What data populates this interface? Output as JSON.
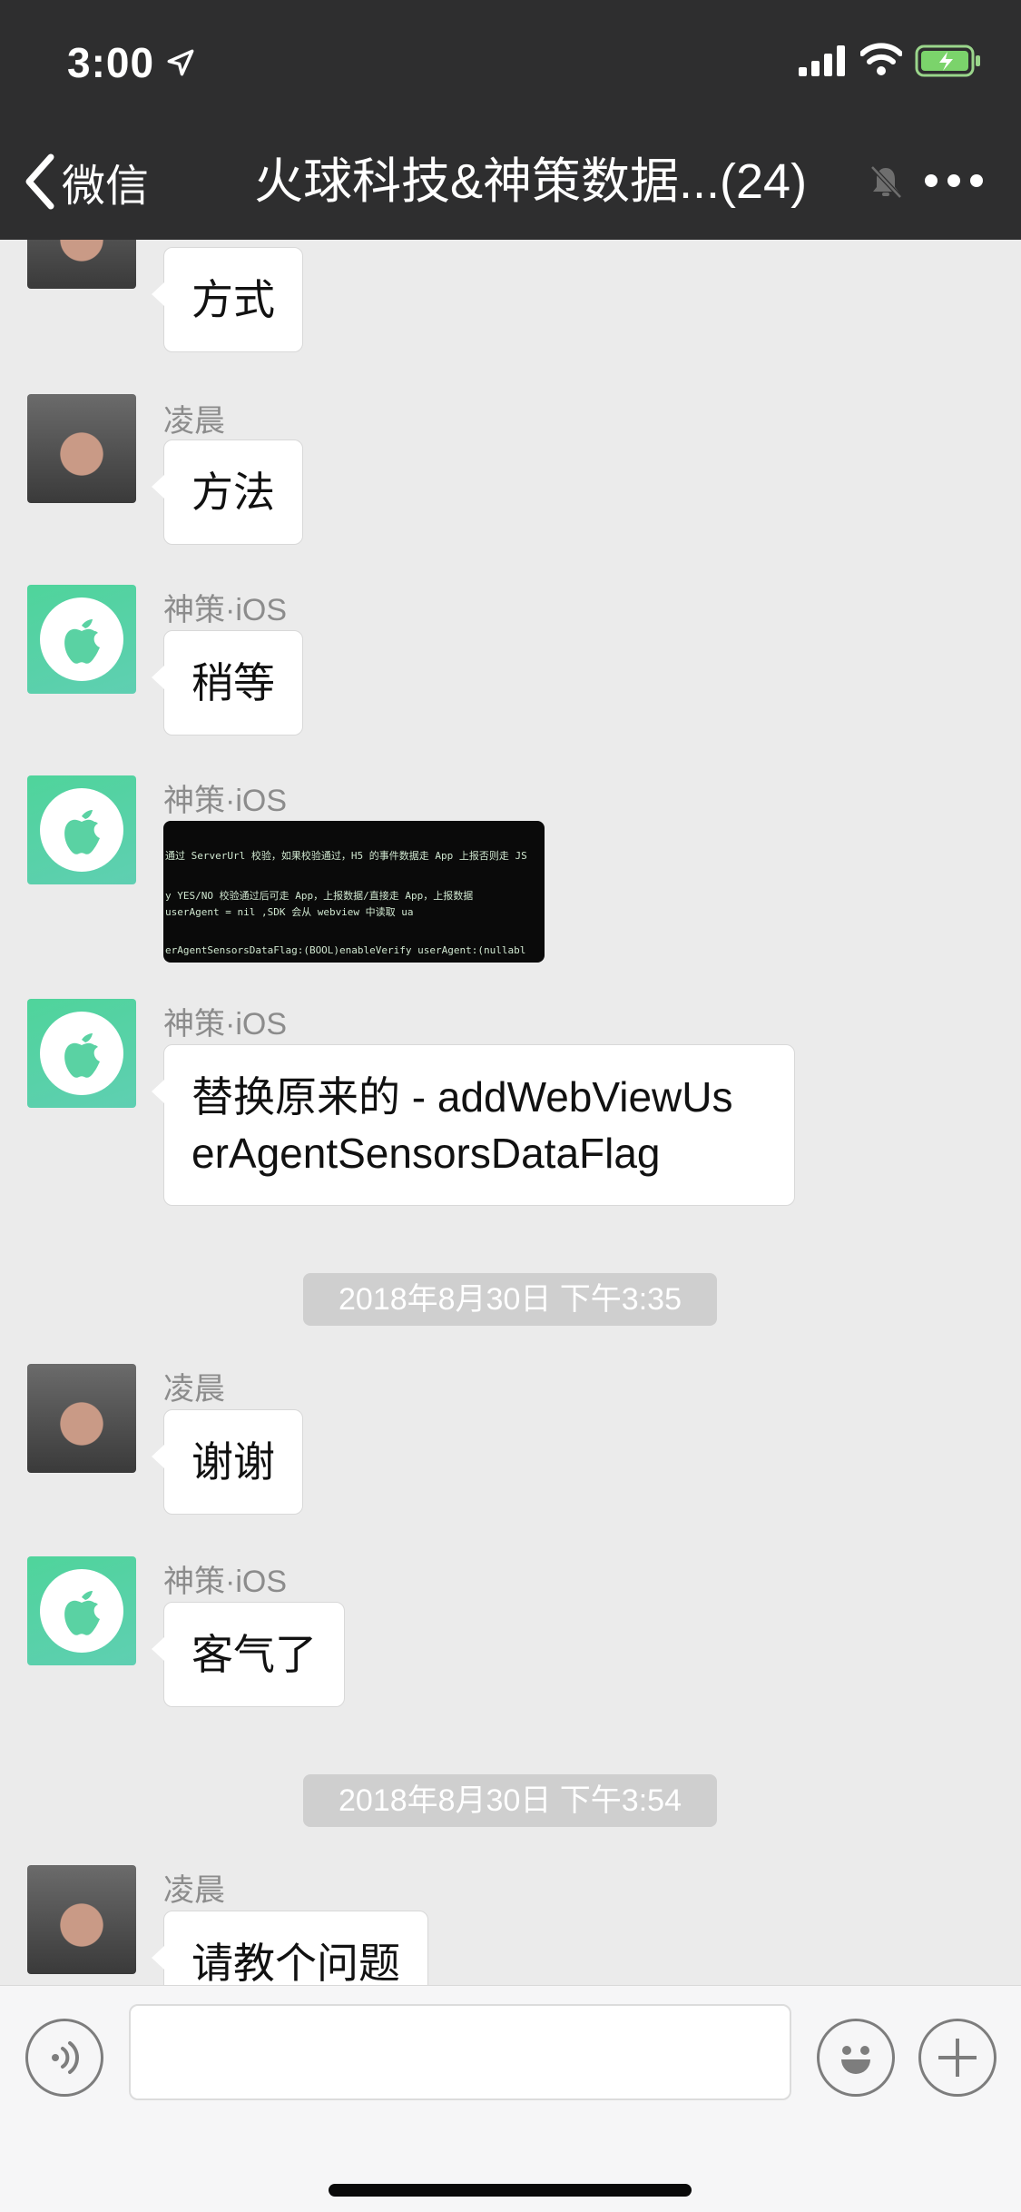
{
  "status": {
    "time": "3:00"
  },
  "header": {
    "back_label": "微信",
    "title": "火球科技&神策数据...(24)"
  },
  "messages": [
    {
      "sender": "",
      "text": "方式"
    },
    {
      "sender": "凌晨",
      "text": "方法"
    },
    {
      "sender": "神策·iOS",
      "text": "稍等"
    },
    {
      "sender": "神策·iOS",
      "image_lines": [
        "通过 ServerUrl 校验，如果校验通过，H5 的事件数据走 App 上报否则走 JS",
        "y YES/NO   校验通过后可走 App，上报数据/直接走 App，上报数据",
        "userAgent = nil ,SDK 会从 webview 中读取 ua",
        "erAgentSensorsDataFlag:(BOOL)enableVerify userAgent:(nullabl"
      ]
    },
    {
      "sender": "神策·iOS",
      "text_line1": "替换原来的 - addWebViewUs",
      "text_line2": "erAgentSensorsDataFlag"
    },
    {
      "timestamp": "2018年8月30日 下午3:35"
    },
    {
      "sender": "凌晨",
      "text": "谢谢"
    },
    {
      "sender": "神策·iOS",
      "text": "客气了"
    },
    {
      "timestamp": "2018年8月30日 下午3:54"
    },
    {
      "sender": "凌晨",
      "text": "请教个问题"
    }
  ],
  "input": {
    "placeholder": ""
  },
  "colors": {
    "header_bg": "#2e2e2f",
    "chat_bg": "#ebebeb",
    "ios_avatar": "#4fd49b"
  }
}
